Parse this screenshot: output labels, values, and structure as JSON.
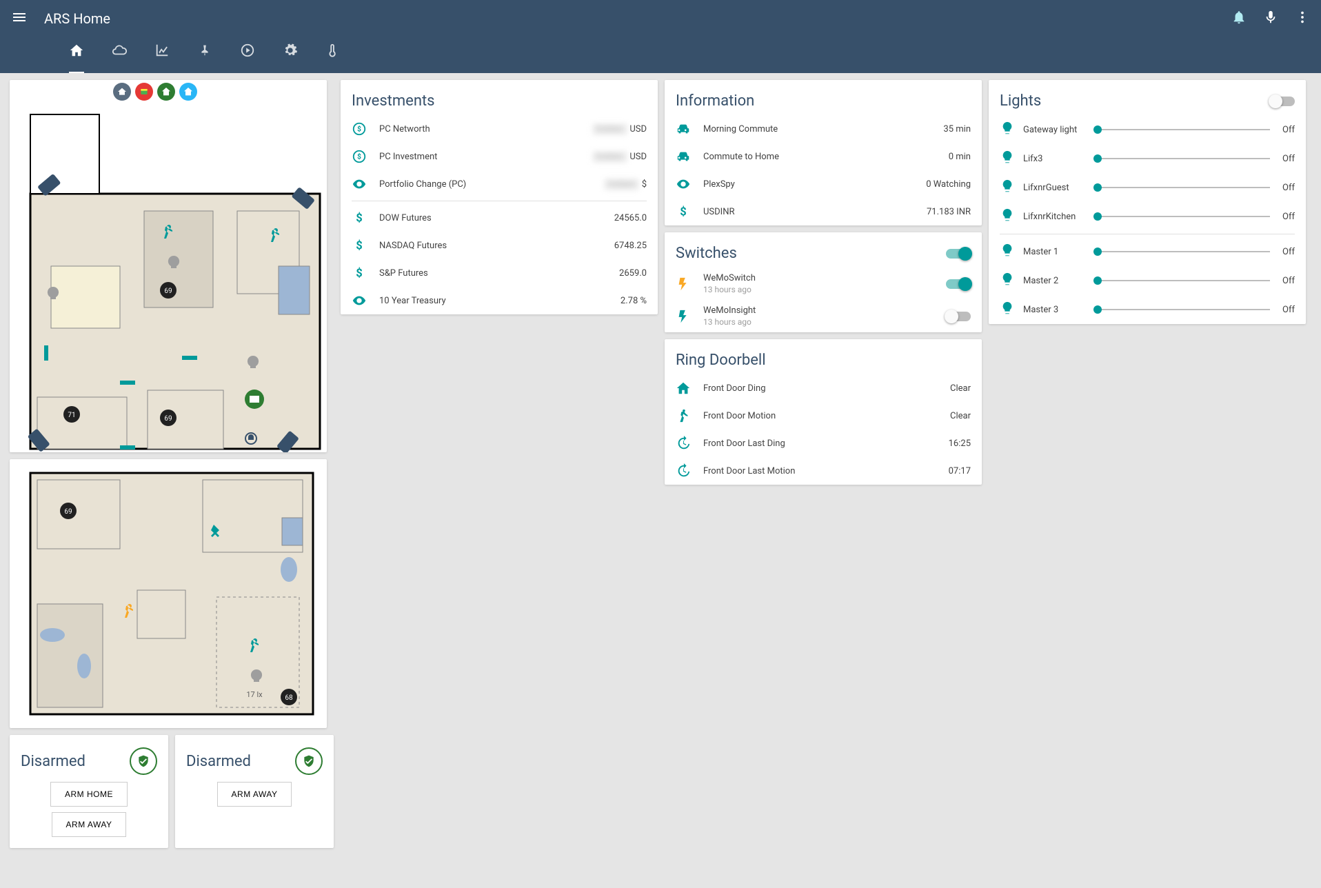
{
  "header": {
    "title": "ARS Home"
  },
  "investments": {
    "title": "Investments",
    "rows": [
      {
        "icon": "dollar-circle",
        "label": "PC Networth",
        "value": "",
        "blurred": true,
        "suffix": " USD"
      },
      {
        "icon": "dollar-circle",
        "label": "PC Investment",
        "value": "",
        "blurred": true,
        "suffix": " USD"
      },
      {
        "icon": "eye",
        "label": "Portfolio Change (PC)",
        "value": "",
        "blurred": true,
        "suffix": " $"
      }
    ],
    "rows2": [
      {
        "icon": "dollar",
        "label": "DOW Futures",
        "value": "24565.0"
      },
      {
        "icon": "dollar",
        "label": "NASDAQ Futures",
        "value": "6748.25"
      },
      {
        "icon": "dollar",
        "label": "S&P Futures",
        "value": "2659.0"
      },
      {
        "icon": "eye",
        "label": "10 Year Treasury",
        "value": "2.78 %"
      }
    ]
  },
  "information": {
    "title": "Information",
    "rows": [
      {
        "icon": "car",
        "label": "Morning Commute",
        "value": "35 min"
      },
      {
        "icon": "car",
        "label": "Commute to Home",
        "value": "0 min"
      },
      {
        "icon": "eye",
        "label": "PlexSpy",
        "value": "0 Watching"
      },
      {
        "icon": "dollar",
        "label": "USDINR",
        "value": "71.183 INR"
      }
    ]
  },
  "switches": {
    "title": "Switches",
    "master_on": true,
    "rows": [
      {
        "icon": "flash",
        "label": "WeMoSwitch",
        "sub": "13 hours ago",
        "on": true,
        "yellow": true
      },
      {
        "icon": "flash",
        "label": "WeMoInsight",
        "sub": "13 hours ago",
        "on": false,
        "yellow": false
      }
    ]
  },
  "doorbell": {
    "title": "Ring Doorbell",
    "rows": [
      {
        "icon": "home",
        "label": "Front Door Ding",
        "value": "Clear"
      },
      {
        "icon": "walk",
        "label": "Front Door Motion",
        "value": "Clear"
      },
      {
        "icon": "history",
        "label": "Front Door Last Ding",
        "value": "16:25"
      },
      {
        "icon": "history",
        "label": "Front Door Last Motion",
        "value": "07:17"
      }
    ]
  },
  "lights": {
    "title": "Lights",
    "master_on": false,
    "group1": [
      {
        "name": "Gateway light",
        "state": "Off"
      },
      {
        "name": "Lifx3",
        "state": "Off"
      },
      {
        "name": "LifxnrGuest",
        "state": "Off"
      },
      {
        "name": "LifxnrKitchen",
        "state": "Off"
      }
    ],
    "group2": [
      {
        "name": "Master 1",
        "state": "Off"
      },
      {
        "name": "Master 2",
        "state": "Off"
      },
      {
        "name": "Master 3",
        "state": "Off"
      }
    ]
  },
  "alarm": [
    {
      "state": "Disarmed",
      "buttons": [
        "ARM HOME",
        "ARM AWAY"
      ]
    },
    {
      "state": "Disarmed",
      "buttons": [
        "ARM AWAY"
      ]
    }
  ],
  "floor1_labels": {
    "t1": "69",
    "t2": "71",
    "t3": "69"
  },
  "floor2_labels": {
    "t1": "69",
    "lux": "17 lx",
    "t2": "68"
  }
}
